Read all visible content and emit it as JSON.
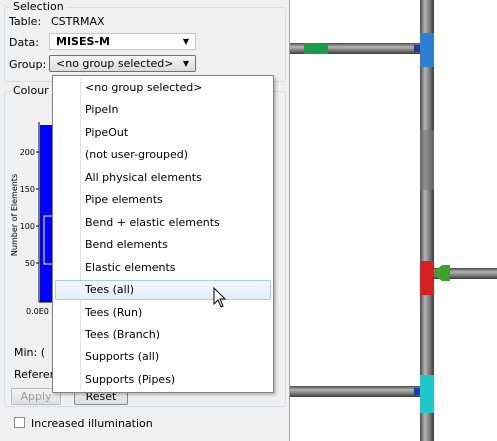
{
  "selection": {
    "title": "Selection",
    "table_label": "Table:",
    "table_value": "CSTRMAX",
    "data_label": "Data:",
    "data_value": "MISES-M",
    "group_label": "Group:",
    "group_value": "<no group selected>"
  },
  "colour_scale": {
    "title_partial": "Colour s",
    "y_axis_label": "Number of Elements",
    "y_ticks": [
      "200",
      "150",
      "100",
      "50"
    ],
    "x_tick_first": "0.0E0",
    "min_label": "Min: (",
    "reference_label": "Referen",
    "bar_color": "#0000ff"
  },
  "buttons": {
    "apply": "Apply",
    "reset": "Reset"
  },
  "options": {
    "increased_illumination": "Increased illumination",
    "increased_illumination_checked": false
  },
  "dropdown": {
    "items": [
      "<no group selected>",
      "PipeIn",
      "PipeOut",
      "(not user-grouped)",
      "All physical elements",
      "Pipe elements",
      "Bend + elastic elements",
      "Bend elements",
      "Elastic elements",
      "Tees (all)",
      "Tees (Run)",
      "Tees (Branch)",
      "Supports (all)",
      "Supports (Pipes)"
    ],
    "highlighted_index": 9
  }
}
